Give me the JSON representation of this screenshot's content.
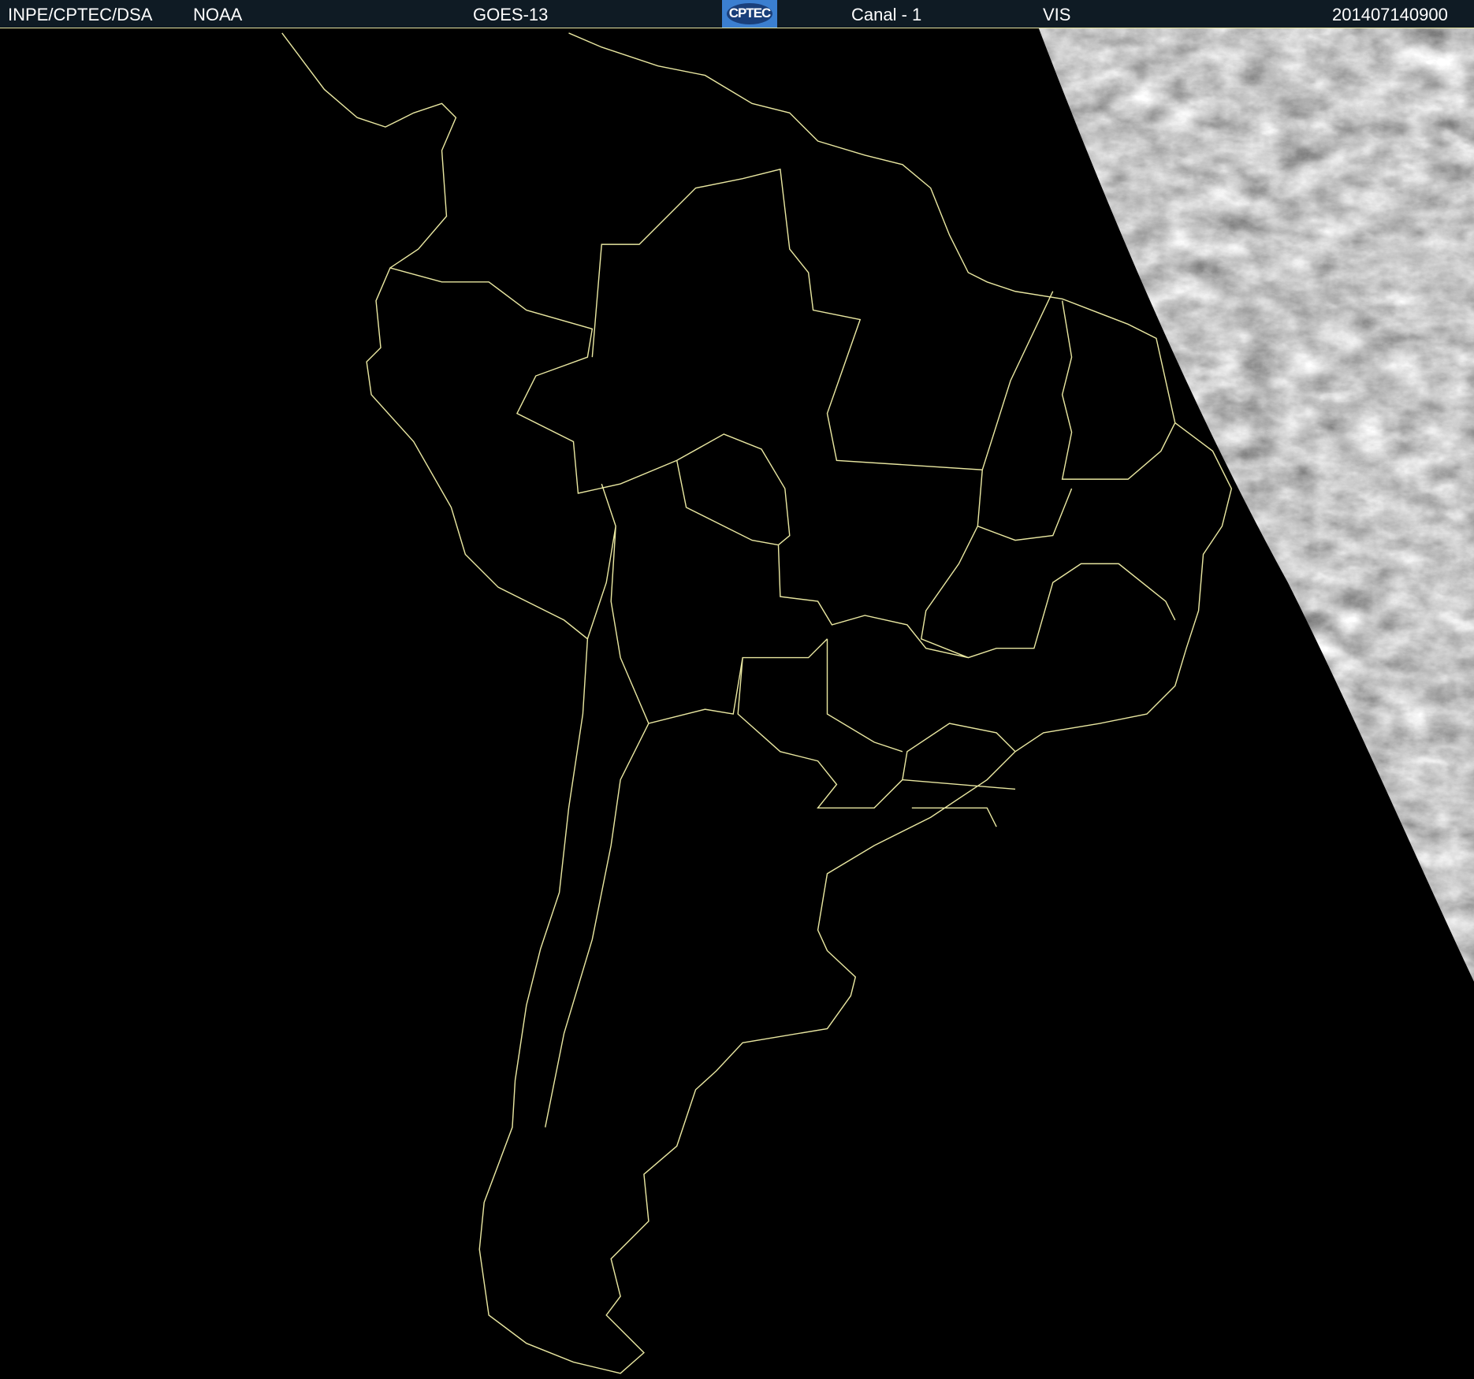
{
  "header": {
    "agency": "INPE/CPTEC/DSA",
    "source": "NOAA",
    "satellite": "GOES-13",
    "logo_text": "CPTEC",
    "channel": "Canal - 1",
    "band": "VIS",
    "timestamp": "201407140900"
  },
  "colors": {
    "header_bg": "#0f1b24",
    "outline": "#e8e6a0",
    "background": "#000000"
  }
}
